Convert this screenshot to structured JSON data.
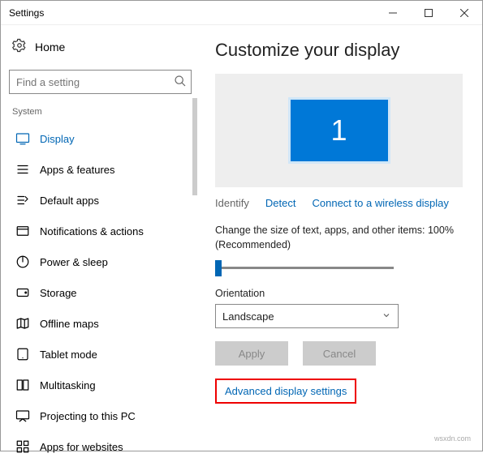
{
  "window": {
    "title": "Settings"
  },
  "home": {
    "label": "Home"
  },
  "search": {
    "placeholder": "Find a setting"
  },
  "section": {
    "label": "System"
  },
  "nav": [
    {
      "key": "display",
      "label": "Display",
      "active": true
    },
    {
      "key": "apps",
      "label": "Apps & features",
      "active": false
    },
    {
      "key": "defaultapps",
      "label": "Default apps",
      "active": false
    },
    {
      "key": "notifications",
      "label": "Notifications & actions",
      "active": false
    },
    {
      "key": "power",
      "label": "Power & sleep",
      "active": false
    },
    {
      "key": "storage",
      "label": "Storage",
      "active": false
    },
    {
      "key": "offlinemaps",
      "label": "Offline maps",
      "active": false
    },
    {
      "key": "tabletmode",
      "label": "Tablet mode",
      "active": false
    },
    {
      "key": "multitasking",
      "label": "Multitasking",
      "active": false
    },
    {
      "key": "projecting",
      "label": "Projecting to this PC",
      "active": false
    },
    {
      "key": "appsweb",
      "label": "Apps for websites",
      "active": false
    }
  ],
  "main": {
    "heading": "Customize your display",
    "monitor_id": "1",
    "identify": "Identify",
    "detect": "Detect",
    "connect": "Connect to a wireless display",
    "scale_label": "Change the size of text, apps, and other items: 100% (Recommended)",
    "orientation_label": "Orientation",
    "orientation_value": "Landscape",
    "apply": "Apply",
    "cancel": "Cancel",
    "advanced": "Advanced display settings"
  },
  "watermark": "wsxdn.com"
}
